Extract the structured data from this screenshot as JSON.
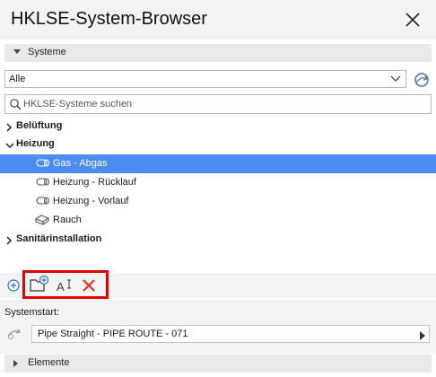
{
  "window": {
    "title": "HKLSE-System-Browser"
  },
  "systeme_section": {
    "label": "Systeme"
  },
  "filter": {
    "selected": "Alle"
  },
  "search": {
    "placeholder": "HKLSE-Systeme suchen"
  },
  "tree": {
    "groups": [
      {
        "label": "Belüftung",
        "expanded": false
      },
      {
        "label": "Heizung",
        "expanded": true,
        "children": [
          {
            "label": "Gas - Abgas",
            "selected": true,
            "icon": "pipe-icon"
          },
          {
            "label": "Heizung - Rücklauf",
            "icon": "pipe-icon"
          },
          {
            "label": "Heizung - Vorlauf",
            "icon": "pipe-icon"
          },
          {
            "label": "Rauch",
            "icon": "duct-icon"
          }
        ]
      },
      {
        "label": "Sanitärinstallation",
        "expanded": false
      }
    ]
  },
  "toolbar": {
    "icons": [
      "add-circle-icon",
      "new-folder-icon",
      "rename-text-icon",
      "delete-x-icon"
    ],
    "highlight_color": "#e40000"
  },
  "systemstart": {
    "label": "Systemstart:",
    "value": "Pipe Straight - PIPE ROUTE - 071"
  },
  "elemente_section": {
    "label": "Elemente"
  },
  "colors": {
    "selection": "#4a8cf0",
    "delete": "#e0302a",
    "accent_icon": "#2b6fd6"
  }
}
